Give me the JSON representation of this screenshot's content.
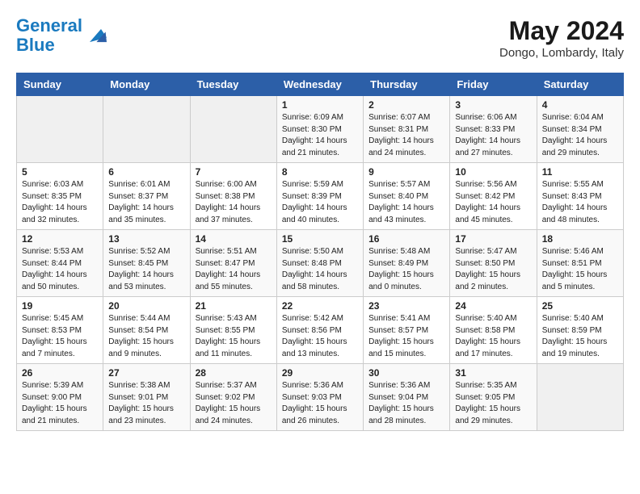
{
  "header": {
    "logo_line1": "General",
    "logo_line2": "Blue",
    "month_year": "May 2024",
    "location": "Dongo, Lombardy, Italy"
  },
  "weekdays": [
    "Sunday",
    "Monday",
    "Tuesday",
    "Wednesday",
    "Thursday",
    "Friday",
    "Saturday"
  ],
  "weeks": [
    [
      {
        "day": "",
        "info": ""
      },
      {
        "day": "",
        "info": ""
      },
      {
        "day": "",
        "info": ""
      },
      {
        "day": "1",
        "info": "Sunrise: 6:09 AM\nSunset: 8:30 PM\nDaylight: 14 hours\nand 21 minutes."
      },
      {
        "day": "2",
        "info": "Sunrise: 6:07 AM\nSunset: 8:31 PM\nDaylight: 14 hours\nand 24 minutes."
      },
      {
        "day": "3",
        "info": "Sunrise: 6:06 AM\nSunset: 8:33 PM\nDaylight: 14 hours\nand 27 minutes."
      },
      {
        "day": "4",
        "info": "Sunrise: 6:04 AM\nSunset: 8:34 PM\nDaylight: 14 hours\nand 29 minutes."
      }
    ],
    [
      {
        "day": "5",
        "info": "Sunrise: 6:03 AM\nSunset: 8:35 PM\nDaylight: 14 hours\nand 32 minutes."
      },
      {
        "day": "6",
        "info": "Sunrise: 6:01 AM\nSunset: 8:37 PM\nDaylight: 14 hours\nand 35 minutes."
      },
      {
        "day": "7",
        "info": "Sunrise: 6:00 AM\nSunset: 8:38 PM\nDaylight: 14 hours\nand 37 minutes."
      },
      {
        "day": "8",
        "info": "Sunrise: 5:59 AM\nSunset: 8:39 PM\nDaylight: 14 hours\nand 40 minutes."
      },
      {
        "day": "9",
        "info": "Sunrise: 5:57 AM\nSunset: 8:40 PM\nDaylight: 14 hours\nand 43 minutes."
      },
      {
        "day": "10",
        "info": "Sunrise: 5:56 AM\nSunset: 8:42 PM\nDaylight: 14 hours\nand 45 minutes."
      },
      {
        "day": "11",
        "info": "Sunrise: 5:55 AM\nSunset: 8:43 PM\nDaylight: 14 hours\nand 48 minutes."
      }
    ],
    [
      {
        "day": "12",
        "info": "Sunrise: 5:53 AM\nSunset: 8:44 PM\nDaylight: 14 hours\nand 50 minutes."
      },
      {
        "day": "13",
        "info": "Sunrise: 5:52 AM\nSunset: 8:45 PM\nDaylight: 14 hours\nand 53 minutes."
      },
      {
        "day": "14",
        "info": "Sunrise: 5:51 AM\nSunset: 8:47 PM\nDaylight: 14 hours\nand 55 minutes."
      },
      {
        "day": "15",
        "info": "Sunrise: 5:50 AM\nSunset: 8:48 PM\nDaylight: 14 hours\nand 58 minutes."
      },
      {
        "day": "16",
        "info": "Sunrise: 5:48 AM\nSunset: 8:49 PM\nDaylight: 15 hours\nand 0 minutes."
      },
      {
        "day": "17",
        "info": "Sunrise: 5:47 AM\nSunset: 8:50 PM\nDaylight: 15 hours\nand 2 minutes."
      },
      {
        "day": "18",
        "info": "Sunrise: 5:46 AM\nSunset: 8:51 PM\nDaylight: 15 hours\nand 5 minutes."
      }
    ],
    [
      {
        "day": "19",
        "info": "Sunrise: 5:45 AM\nSunset: 8:53 PM\nDaylight: 15 hours\nand 7 minutes."
      },
      {
        "day": "20",
        "info": "Sunrise: 5:44 AM\nSunset: 8:54 PM\nDaylight: 15 hours\nand 9 minutes."
      },
      {
        "day": "21",
        "info": "Sunrise: 5:43 AM\nSunset: 8:55 PM\nDaylight: 15 hours\nand 11 minutes."
      },
      {
        "day": "22",
        "info": "Sunrise: 5:42 AM\nSunset: 8:56 PM\nDaylight: 15 hours\nand 13 minutes."
      },
      {
        "day": "23",
        "info": "Sunrise: 5:41 AM\nSunset: 8:57 PM\nDaylight: 15 hours\nand 15 minutes."
      },
      {
        "day": "24",
        "info": "Sunrise: 5:40 AM\nSunset: 8:58 PM\nDaylight: 15 hours\nand 17 minutes."
      },
      {
        "day": "25",
        "info": "Sunrise: 5:40 AM\nSunset: 8:59 PM\nDaylight: 15 hours\nand 19 minutes."
      }
    ],
    [
      {
        "day": "26",
        "info": "Sunrise: 5:39 AM\nSunset: 9:00 PM\nDaylight: 15 hours\nand 21 minutes."
      },
      {
        "day": "27",
        "info": "Sunrise: 5:38 AM\nSunset: 9:01 PM\nDaylight: 15 hours\nand 23 minutes."
      },
      {
        "day": "28",
        "info": "Sunrise: 5:37 AM\nSunset: 9:02 PM\nDaylight: 15 hours\nand 24 minutes."
      },
      {
        "day": "29",
        "info": "Sunrise: 5:36 AM\nSunset: 9:03 PM\nDaylight: 15 hours\nand 26 minutes."
      },
      {
        "day": "30",
        "info": "Sunrise: 5:36 AM\nSunset: 9:04 PM\nDaylight: 15 hours\nand 28 minutes."
      },
      {
        "day": "31",
        "info": "Sunrise: 5:35 AM\nSunset: 9:05 PM\nDaylight: 15 hours\nand 29 minutes."
      },
      {
        "day": "",
        "info": ""
      }
    ]
  ]
}
